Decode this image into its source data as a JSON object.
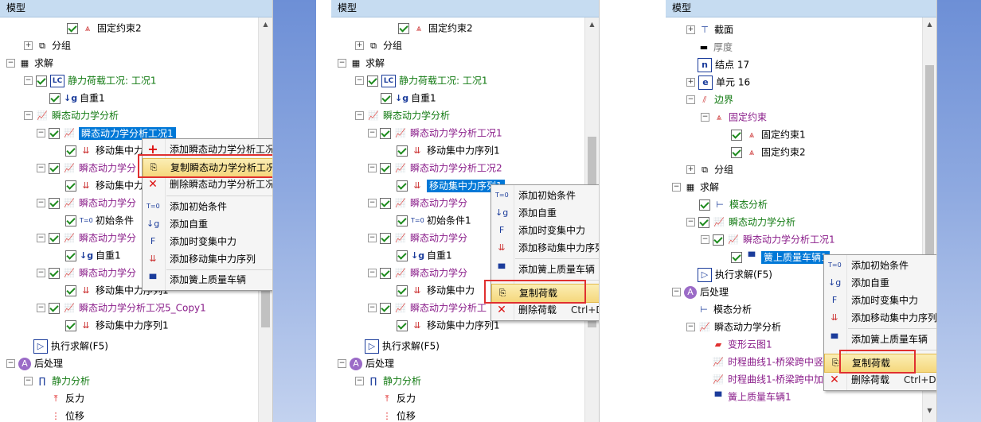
{
  "panel_title": "模型",
  "p1": {
    "tree": [
      {
        "t": "固定约束2",
        "cls": "",
        "icon": "support-icon"
      },
      {
        "t": "分组",
        "cls": "",
        "icon": "group-icon"
      },
      {
        "t": "求解",
        "cls": "",
        "icon": "solve-icon"
      },
      {
        "t": "静力荷载工况: 工况1",
        "cls": "green",
        "icon": "lc-icon"
      },
      {
        "t": "自重1",
        "cls": "",
        "icon": "gravity-icon"
      },
      {
        "t": "瞬态动力学分析",
        "cls": "green",
        "icon": "transient-icon"
      },
      {
        "t": "瞬态动力学分析工况1",
        "cls": "sel",
        "icon": "transient-icon"
      },
      {
        "t": "移动集中力",
        "cls": "",
        "icon": "moving-load-icon"
      },
      {
        "t": "瞬态动力学分",
        "cls": "purple",
        "icon": "transient-icon"
      },
      {
        "t": "移动集中力",
        "cls": "",
        "icon": "moving-load-icon"
      },
      {
        "t": "瞬态动力学分",
        "cls": "purple",
        "icon": "transient-icon"
      },
      {
        "t": "初始条件",
        "cls": "",
        "icon": "initial-icon"
      },
      {
        "t": "瞬态动力学分",
        "cls": "purple",
        "icon": "transient-icon"
      },
      {
        "t": "自重1",
        "cls": "",
        "icon": "gravity-icon"
      },
      {
        "t": "瞬态动力学分",
        "cls": "purple",
        "icon": "transient-icon"
      },
      {
        "t": "移动集中力序列1",
        "cls": "",
        "icon": "moving-load-icon"
      },
      {
        "t": "瞬态动力学分析工况5_Copy1",
        "cls": "purple",
        "icon": "transient-icon"
      },
      {
        "t": "移动集中力序列1",
        "cls": "",
        "icon": "moving-load-icon"
      },
      {
        "t": "执行求解(F5)",
        "cls": "",
        "icon": "run-icon"
      },
      {
        "t": "后处理",
        "cls": "",
        "icon": "post-icon"
      },
      {
        "t": "静力分析",
        "cls": "green",
        "icon": "static-icon"
      },
      {
        "t": "反力",
        "cls": "",
        "icon": "reaction-icon"
      },
      {
        "t": "位移",
        "cls": "",
        "icon": "displacement-icon"
      }
    ],
    "menu": [
      "添加瞬态动力学分析工况",
      "复制瞬态动力学分析工况",
      "删除瞬态动力学分析工况",
      "添加初始条件",
      "添加自重",
      "添加时变集中力",
      "添加移动集中力序列",
      "添加簧上质量车辆"
    ]
  },
  "p2": {
    "tree": [
      {
        "t": "固定约束2",
        "cls": ""
      },
      {
        "t": "分组",
        "cls": ""
      },
      {
        "t": "求解",
        "cls": ""
      },
      {
        "t": "静力荷载工况: 工况1",
        "cls": "green"
      },
      {
        "t": "自重1",
        "cls": ""
      },
      {
        "t": "瞬态动力学分析",
        "cls": "green"
      },
      {
        "t": "瞬态动力学分析工况1",
        "cls": "purple"
      },
      {
        "t": "移动集中力序列1",
        "cls": ""
      },
      {
        "t": "瞬态动力学分析工况2",
        "cls": "purple"
      },
      {
        "t": "移动集中力序列1",
        "cls": "sel"
      },
      {
        "t": "瞬态动力学分",
        "cls": "purple"
      },
      {
        "t": "初始条件1",
        "cls": ""
      },
      {
        "t": "瞬态动力学分",
        "cls": "purple"
      },
      {
        "t": "自重1",
        "cls": ""
      },
      {
        "t": "瞬态动力学分",
        "cls": "purple"
      },
      {
        "t": "移动集中力",
        "cls": ""
      },
      {
        "t": "瞬态动力学分析工",
        "cls": "purple"
      },
      {
        "t": "移动集中力序列1",
        "cls": ""
      },
      {
        "t": "执行求解(F5)",
        "cls": ""
      },
      {
        "t": "后处理",
        "cls": ""
      },
      {
        "t": "静力分析",
        "cls": "green"
      },
      {
        "t": "反力",
        "cls": ""
      },
      {
        "t": "位移",
        "cls": ""
      }
    ],
    "menu": [
      "添加初始条件",
      "添加自重",
      "添加时变集中力",
      "添加移动集中力序列",
      "添加簧上质量车辆",
      "复制荷载",
      "删除荷载"
    ],
    "menu_shortcut": "Ctrl+Delete"
  },
  "p3": {
    "tree": [
      {
        "t": "截面",
        "cls": ""
      },
      {
        "t": "厚度",
        "cls": "gray"
      },
      {
        "t": "结点 17",
        "cls": ""
      },
      {
        "t": "单元 16",
        "cls": ""
      },
      {
        "t": "边界",
        "cls": "green"
      },
      {
        "t": "固定约束",
        "cls": "purple"
      },
      {
        "t": "固定约束1",
        "cls": ""
      },
      {
        "t": "固定约束2",
        "cls": ""
      },
      {
        "t": "分组",
        "cls": ""
      },
      {
        "t": "求解",
        "cls": ""
      },
      {
        "t": "模态分析",
        "cls": "green"
      },
      {
        "t": "瞬态动力学分析",
        "cls": "green"
      },
      {
        "t": "瞬态动力学分析工况1",
        "cls": "purple"
      },
      {
        "t": "簧上质量车辆1",
        "cls": "sel"
      },
      {
        "t": "执行求解(F5)",
        "cls": ""
      },
      {
        "t": "后处理",
        "cls": ""
      },
      {
        "t": "模态分析",
        "cls": ""
      },
      {
        "t": "瞬态动力学分析",
        "cls": ""
      },
      {
        "t": "变形云图1",
        "cls": "purple"
      },
      {
        "t": "时程曲线1-桥梁跨中竖",
        "cls": "purple"
      },
      {
        "t": "时程曲线1-桥梁跨中加",
        "cls": "purple"
      },
      {
        "t": "簧上质量车辆1",
        "cls": "purple"
      }
    ],
    "menu": [
      "添加初始条件",
      "添加自重",
      "添加时变集中力",
      "添加移动集中力序列",
      "添加簧上质量车辆",
      "复制荷载",
      "删除荷载"
    ],
    "menu_shortcut": "Ctrl+Delete"
  },
  "colors": {
    "selection": "#0078d7",
    "highlight": "#f5d77c",
    "redbox": "#e03030",
    "title_bg": "#c6dcf1"
  }
}
